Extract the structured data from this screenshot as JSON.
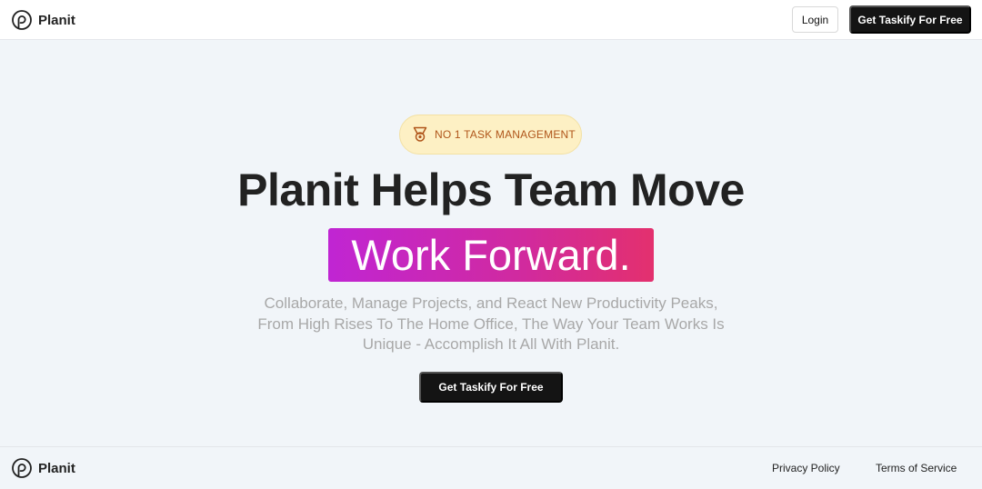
{
  "header": {
    "brand_name": "Planit",
    "logo_icon": "planit-logo-icon",
    "login_label": "Login",
    "cta_label": "Get Taskify For Free"
  },
  "hero": {
    "badge_icon": "medal-icon",
    "badge_text": "NO 1 TASK MANAGEMENT",
    "headline": "Planit Helps Team Move",
    "highlight": "Work Forward.",
    "subtext": "Collaborate, Manage Projects, and React New Productivity Peaks, From High Rises To The Home Office, The Way Your Team Works Is Unique - Accomplish It All With Planit.",
    "cta_label": "Get Taskify For Free"
  },
  "footer": {
    "brand_name": "Planit",
    "links": [
      "Privacy Policy",
      "Terms of Service"
    ]
  },
  "colors": {
    "background": "#f1f5f9",
    "dark_button": "#141414",
    "badge_bg": "#fdf0c4",
    "badge_text": "#b0561b",
    "gradient_start": "#c025d3",
    "gradient_end": "#e3306e",
    "subtext": "#a8a8a8"
  }
}
